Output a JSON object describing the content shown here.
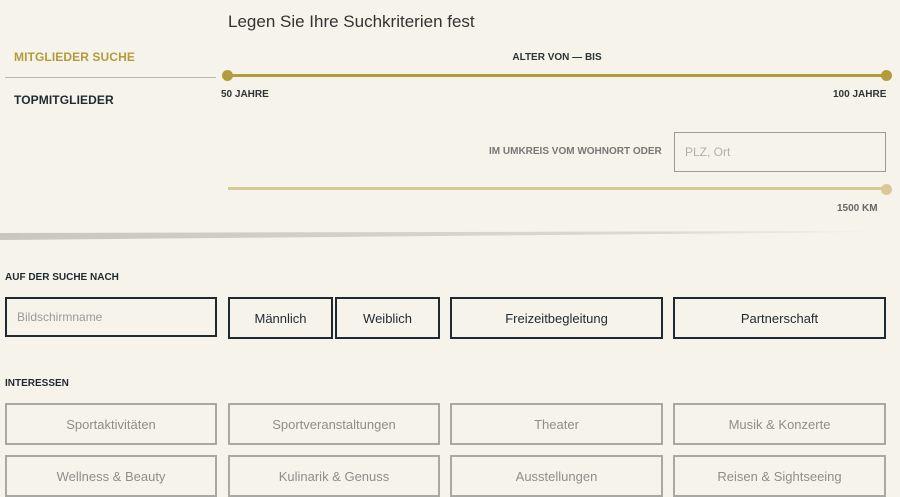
{
  "heading": "Legen Sie Ihre Suchkriterien fest",
  "sidebar": {
    "items": [
      {
        "label": "MITGLIEDER SUCHE",
        "active": true
      },
      {
        "label": "TOPMITGLIEDER",
        "active": false
      }
    ]
  },
  "age": {
    "title": "ALTER VON — BIS",
    "min_label": "50 JAHRE",
    "max_label": "100 JAHRE",
    "min_value": 50,
    "max_value": 100
  },
  "radius": {
    "label": "IM UMKREIS VOM WOHNORT ODER",
    "placeholder": "PLZ, Ort",
    "value_label": "1500 KM",
    "value": 1500
  },
  "search": {
    "title": "AUF DER SUCHE NACH",
    "name_placeholder": "Bildschirmname",
    "options": [
      "Männlich",
      "Weiblich",
      "Freizeitbegleitung",
      "Partnerschaft"
    ]
  },
  "interests": {
    "title": "INTERESSEN",
    "options": [
      "Sportaktivitäten",
      "Sportveranstaltungen",
      "Theater",
      "Musik & Konzerte",
      "Wellness & Beauty",
      "Kulinarik & Genuss",
      "Ausstellungen",
      "Reisen & Sightseeing"
    ]
  },
  "colors": {
    "accent": "#b49b3e",
    "accent_light": "#d9c99a",
    "background": "#f6f3ea",
    "dark": "#1f2a30"
  }
}
